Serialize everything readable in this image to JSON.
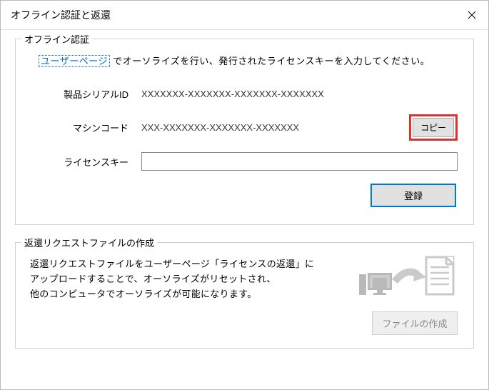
{
  "window": {
    "title": "オフライン認証と返還"
  },
  "group1": {
    "title": "オフライン認証",
    "instruction_link": "ユーザーページ",
    "instruction_rest": " でオーソライズを行い、発行されたライセンスキーを入力してください。",
    "serial_label": "製品シリアルID",
    "serial_value": "XXXXXXX-XXXXXXX-XXXXXXX-XXXXXXX",
    "machine_label": "マシンコード",
    "machine_value": "XXX-XXXXXXX-XXXXXXX-XXXXXXX",
    "copy_label": "コピー",
    "license_label": "ライセンスキー",
    "license_value": "",
    "register_label": "登録"
  },
  "group2": {
    "title": "返還リクエストファイルの作成",
    "text_line1": "返還リクエストファイルをユーザーページ「ライセンスの返還」に",
    "text_line2": "アップロードすることで、オーソライズがリセットされ、",
    "text_line3": "他のコンピュータでオーソライズが可能になります。",
    "create_label": "ファイルの作成"
  }
}
